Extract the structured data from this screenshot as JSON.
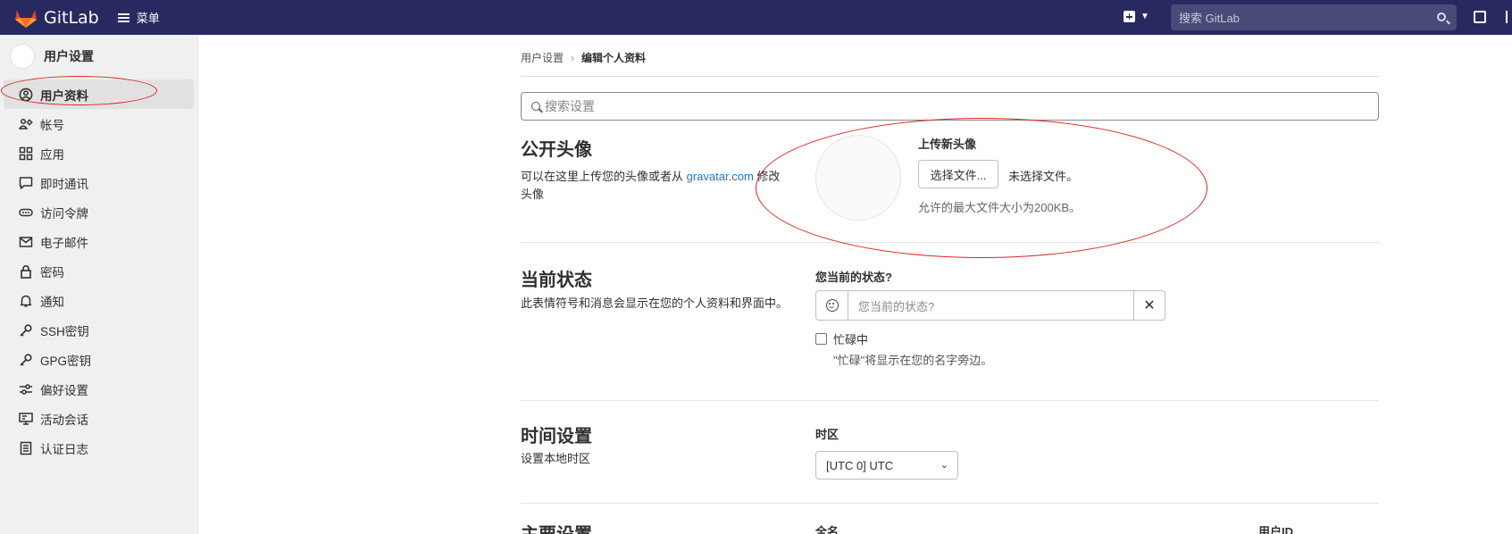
{
  "topbar": {
    "app_name": "GitLab",
    "menu_label": "菜单",
    "search_placeholder": "搜索 GitLab"
  },
  "sidebar": {
    "title": "用户设置",
    "items": [
      {
        "label": "用户资料",
        "icon": "profile-icon",
        "active": true
      },
      {
        "label": "帐号",
        "icon": "account-icon"
      },
      {
        "label": "应用",
        "icon": "applications-icon"
      },
      {
        "label": "即时通讯",
        "icon": "chat-icon"
      },
      {
        "label": "访问令牌",
        "icon": "token-icon"
      },
      {
        "label": "电子邮件",
        "icon": "mail-icon"
      },
      {
        "label": "密码",
        "icon": "lock-icon"
      },
      {
        "label": "通知",
        "icon": "bell-icon"
      },
      {
        "label": "SSH密钥",
        "icon": "key-icon"
      },
      {
        "label": "GPG密钥",
        "icon": "key-icon"
      },
      {
        "label": "偏好设置",
        "icon": "preferences-icon"
      },
      {
        "label": "活动会话",
        "icon": "monitor-icon"
      },
      {
        "label": "认证日志",
        "icon": "log-icon"
      }
    ]
  },
  "breadcrumb": {
    "parent": "用户设置",
    "current": "编辑个人资料"
  },
  "settings_search": {
    "placeholder": "搜索设置"
  },
  "avatar_section": {
    "title": "公开头像",
    "desc_before": "可以在这里上传您的头像或者从 ",
    "link": "gravatar.com",
    "desc_after": " 修改头像",
    "upload_title": "上传新头像",
    "choose_file": "选择文件...",
    "no_file": "未选择文件。",
    "max_size": "允许的最大文件大小为200KB。"
  },
  "status_section": {
    "title": "当前状态",
    "desc": "此表情符号和消息会显示在您的个人资料和界面中。",
    "label": "您当前的状态?",
    "placeholder": "您当前的状态?",
    "clear": "✕",
    "busy_label": "忙碌中",
    "busy_hint": "\"忙碌\"将显示在您的名字旁边。"
  },
  "time_section": {
    "title": "时间设置",
    "desc": "设置本地时区",
    "tz_label": "时区",
    "tz_value": "[UTC 0] UTC"
  },
  "next_section": {
    "title": "主要设置",
    "name_label": "全名",
    "userid_label": "用户ID"
  }
}
